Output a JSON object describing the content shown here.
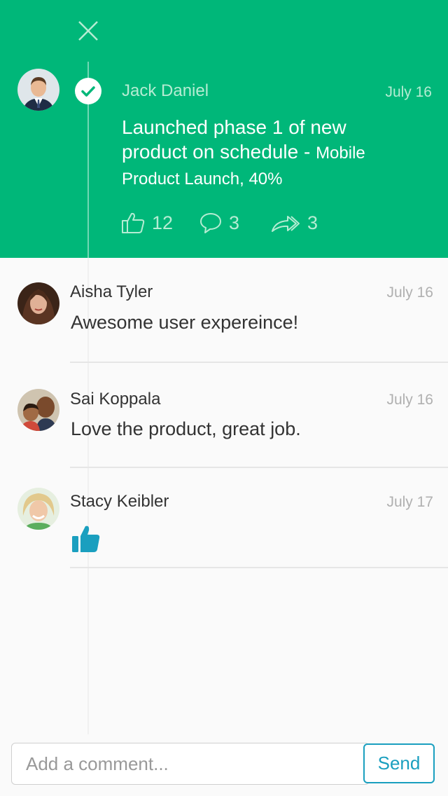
{
  "post": {
    "author": "Jack Daniel",
    "date": "July 16",
    "text_main": "Launched phase 1 of new product on schedule - ",
    "text_context": "Mobile Product Launch, 40%",
    "likes": "12",
    "comments": "3",
    "shares": "3"
  },
  "comments": [
    {
      "name": "Aisha Tyler",
      "date": "July 16",
      "text": "Awesome user expereince!"
    },
    {
      "name": "Sai Koppala",
      "date": "July 16",
      "text": "Love the product, great job."
    },
    {
      "name": "Stacy Keibler",
      "date": "July 17",
      "text": ""
    }
  ],
  "composer": {
    "placeholder": "Add a comment...",
    "send_label": "Send"
  },
  "colors": {
    "header_bg": "#00b779",
    "accent_blue": "#1a9fbf"
  },
  "icons": {
    "close": "close-icon",
    "check": "check-icon",
    "like": "thumbs-up-icon",
    "comment": "speech-bubble-icon",
    "share": "share-arrow-icon",
    "reaction": "thumbs-up-filled-icon"
  }
}
